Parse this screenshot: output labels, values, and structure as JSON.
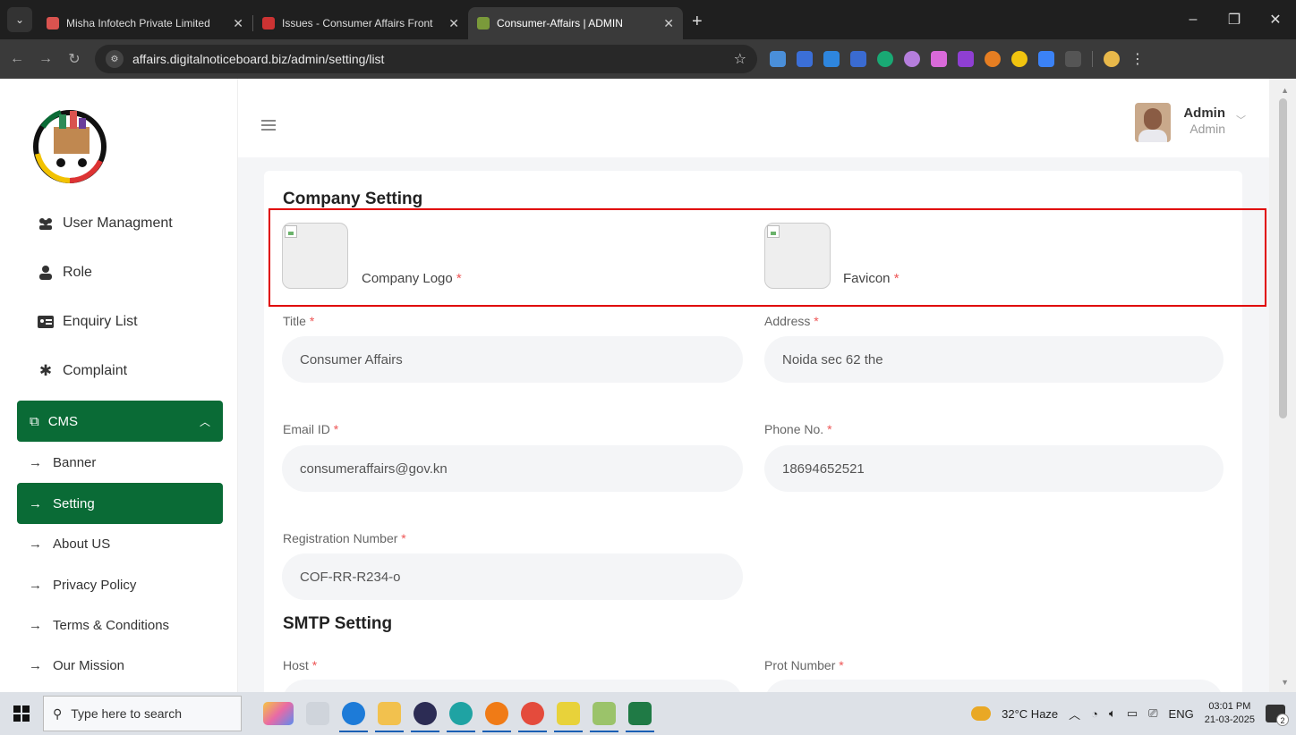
{
  "browser": {
    "tabs": [
      {
        "title": "Misha Infotech Private Limited",
        "color": "#d9534f"
      },
      {
        "title": "Issues - Consumer Affairs Front",
        "color": "#cc3333"
      },
      {
        "title": "Consumer-Affairs | ADMIN",
        "color": "#7a9a3a"
      }
    ],
    "url": "affairs.digitalnoticeboard.biz/admin/setting/list"
  },
  "sidebar": {
    "items": [
      {
        "label": "User Managment",
        "icon": "users-icon"
      },
      {
        "label": "Role",
        "icon": "user-icon"
      },
      {
        "label": "Enquiry List",
        "icon": "id-card-icon"
      },
      {
        "label": "Complaint",
        "icon": "gear-icon"
      }
    ],
    "cms_label": "CMS",
    "cms_subitems": [
      "Banner",
      "Setting",
      "About US",
      "Privacy Policy",
      "Terms & Conditions",
      "Our Mission"
    ],
    "active_subitem": "Setting"
  },
  "header": {
    "user_name": "Admin",
    "user_role": "Admin"
  },
  "company_setting": {
    "heading": "Company Setting",
    "logo_label": "Company Logo",
    "favicon_label": "Favicon",
    "required_mark": "*",
    "fields": {
      "title_label": "Title",
      "title_value": "Consumer Affairs",
      "address_label": "Address",
      "address_value": "Noida sec 62 the",
      "email_label": "Email ID",
      "email_value": "consumeraffairs@gov.kn",
      "phone_label": "Phone No.",
      "phone_value": "18694652521",
      "reg_label": "Registration Number",
      "reg_value": "COF-RR-R234-o"
    }
  },
  "smtp_setting": {
    "heading": "SMTP Setting",
    "host_label": "Host",
    "port_label": "Prot Number"
  },
  "taskbar": {
    "search_placeholder": "Type here to search",
    "weather": "32°C  Haze",
    "lang": "ENG",
    "time": "03:01 PM",
    "date": "21-03-2025",
    "notif_count": "2"
  },
  "colors": {
    "brand_green": "#0a6b36",
    "highlight_red": "#e00000"
  }
}
